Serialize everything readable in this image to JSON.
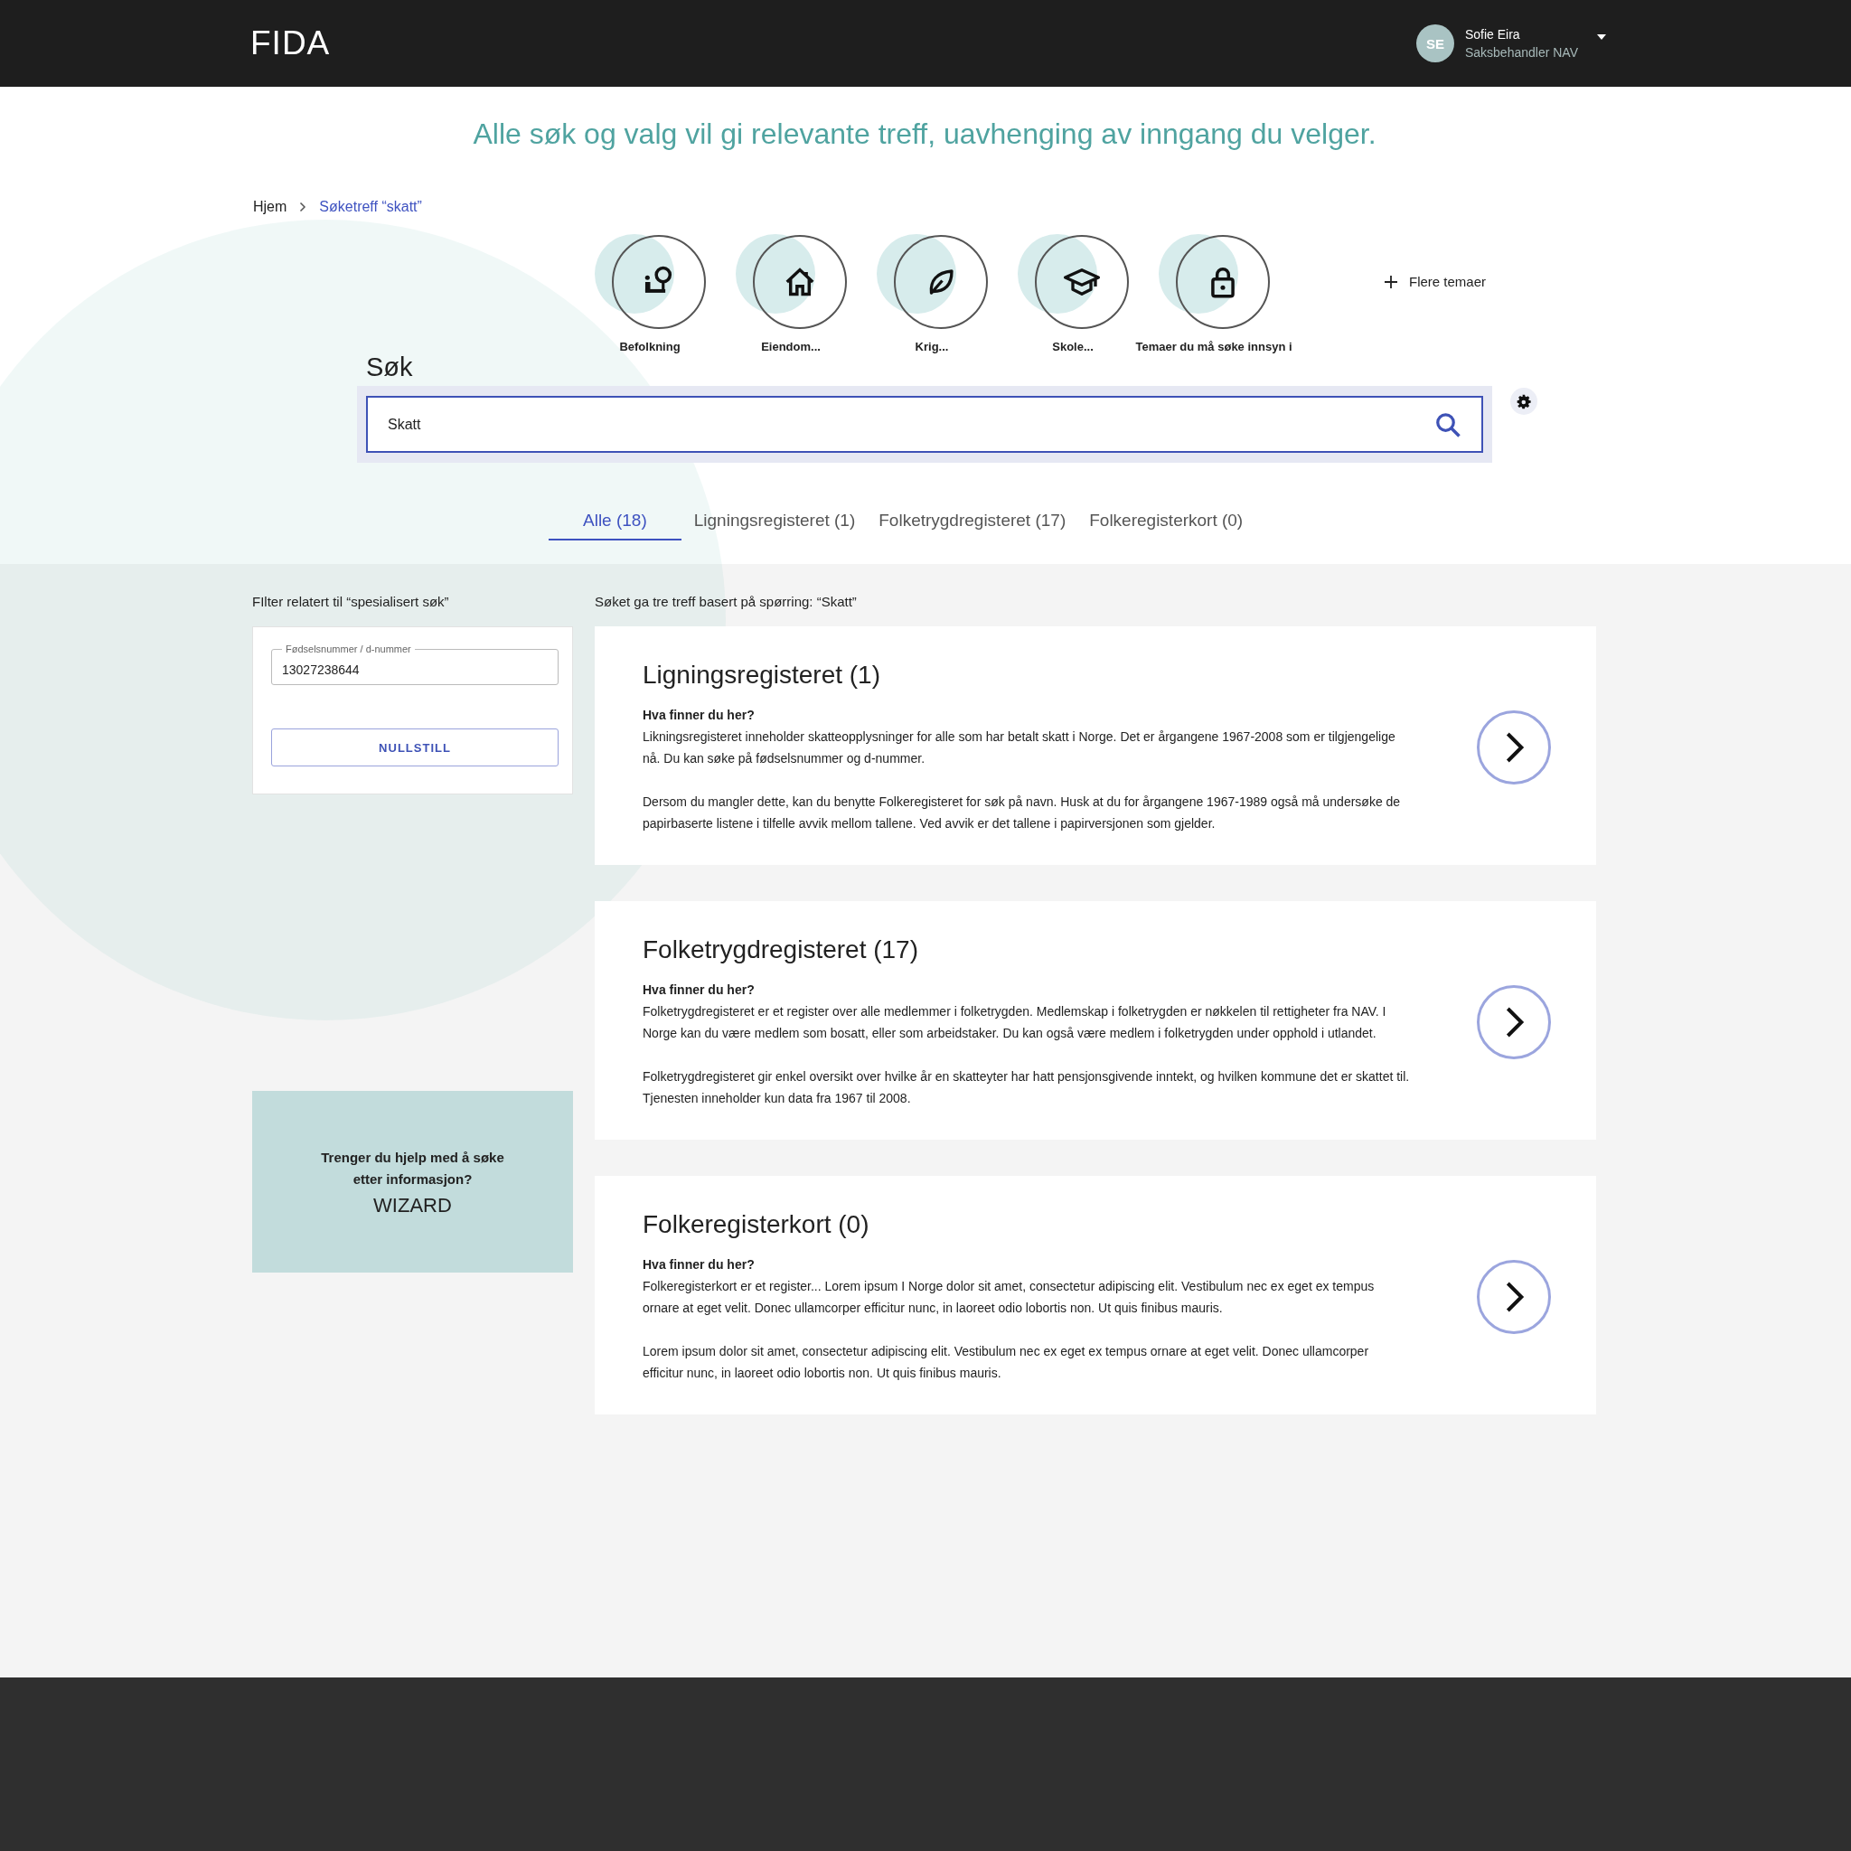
{
  "header": {
    "logo": "FIDA",
    "user": {
      "initials": "SE",
      "name": "Sofie Eira",
      "role": "Saksbehandler NAV"
    }
  },
  "tagline": "Alle søk og valg vil gi relevante treff, uavhenging av inngang du velger.",
  "breadcrumb": [
    {
      "label": "Hjem",
      "current": false
    },
    {
      "label": "Søketreff “skatt”",
      "current": true
    }
  ],
  "themes": [
    {
      "label": "Befolkning"
    },
    {
      "label": "Eiendom..."
    },
    {
      "label": "Krig..."
    },
    {
      "label": "Skole..."
    },
    {
      "label": "Temaer du må søke innsyn i"
    }
  ],
  "more_themes": "Flere temaer",
  "search": {
    "title": "Søk",
    "value": "Skatt"
  },
  "tabs": [
    {
      "label": "Alle (18)",
      "selected": true
    },
    {
      "label": "Ligningsregisteret (1)",
      "selected": false
    },
    {
      "label": "Folketrygdregisteret (17)",
      "selected": false
    },
    {
      "label": "Folkeregisterkort (0)",
      "selected": false
    }
  ],
  "filter": {
    "title": "FIlter relatert til “spesialisert søk”",
    "field_label": "Fødselsnummer / d-nummer",
    "field_value": "13027238644",
    "button": "NULLSTILL"
  },
  "help": {
    "question": "Trenger du hjelp med å søke etter informasjon?",
    "action": "WIZARD"
  },
  "results": {
    "summary": "Søket ga tre treff basert på spørring: “Skatt”",
    "cards": [
      {
        "title": "Ligningsregisteret (1)",
        "subtitle": "Hva finner du her?",
        "paragraphs": [
          "Likningsregisteret inneholder skatteopplysninger for alle som har betalt skatt i Norge. Det er årgangene 1967-2008 som er tilgjengelige nå. Du kan søke på fødselsnummer og d-nummer.",
          "Dersom du mangler dette, kan du benytte Folkeregisteret for søk på navn. Husk at du for årgangene 1967-1989 også må undersøke de papirbaserte listene i tilfelle avvik mellom tallene. Ved avvik er det tallene i papirversjonen som gjelder."
        ]
      },
      {
        "title": "Folketrygdregisteret (17)",
        "subtitle": "Hva finner du her?",
        "paragraphs": [
          "Folketrygdregisteret er et register over alle medlemmer i folketrygden. Medlemskap i folketrygden er nøkkelen til rettigheter fra NAV. I Norge kan du være medlem som bosatt, eller som arbeidstaker. Du kan også være medlem i folketrygden under opphold i utlandet.",
          "Folketrygdregisteret gir enkel oversikt over hvilke år en skatteyter har hatt pensjonsgivende inntekt, og hvilken kommune det er skattet til. Tjenesten inneholder kun data fra 1967 til 2008."
        ]
      },
      {
        "title": "Folkeregisterkort (0)",
        "subtitle": "Hva finner du her?",
        "paragraphs": [
          "Folkeregisterkort er et register... Lorem ipsum I Norge dolor sit amet, consectetur adipiscing elit. Vestibulum nec ex eget ex tempus ornare at eget velit. Donec ullamcorper efficitur nunc, in laoreet odio lobortis non. Ut quis finibus mauris.",
          "Lorem ipsum dolor sit amet, consectetur adipiscing elit. Vestibulum nec ex eget ex tempus ornare at eget velit. Donec ullamcorper efficitur nunc, in laoreet odio lobortis non. Ut quis finibus mauris."
        ]
      }
    ]
  }
}
